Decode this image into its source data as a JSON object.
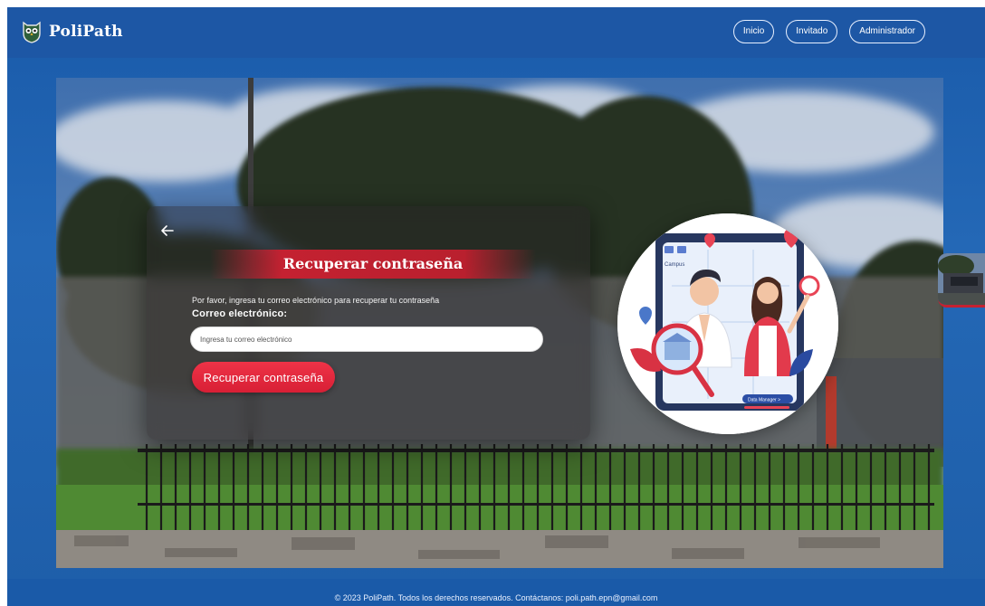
{
  "header": {
    "brand": "PoliPath",
    "nav": [
      {
        "label": "Inicio"
      },
      {
        "label": "Invitado"
      },
      {
        "label": "Administrador"
      }
    ]
  },
  "recovery_card": {
    "title": "Recuperar contraseña",
    "description": "Por favor, ingresa tu correo electrónico para recuperar tu contraseña",
    "email_label": "Correo electrónico:",
    "email_placeholder": "Ingresa tu correo electrónico",
    "email_value": "",
    "submit_label": "Recuperar contraseña"
  },
  "illustration": {
    "screen_label": "Campus",
    "button_label": "Data Manager >"
  },
  "footer": {
    "text": "© 2023 PoliPath. Todos los derechos reservados. Contáctanos: poli.path.epn@gmail.com"
  },
  "colors": {
    "header_bg": "#1d57a5",
    "accent_red": "#d81f35",
    "page_blue": "#2468b6"
  },
  "icons": {
    "back": "arrow-left-icon",
    "logo": "owl-shield-logo"
  }
}
